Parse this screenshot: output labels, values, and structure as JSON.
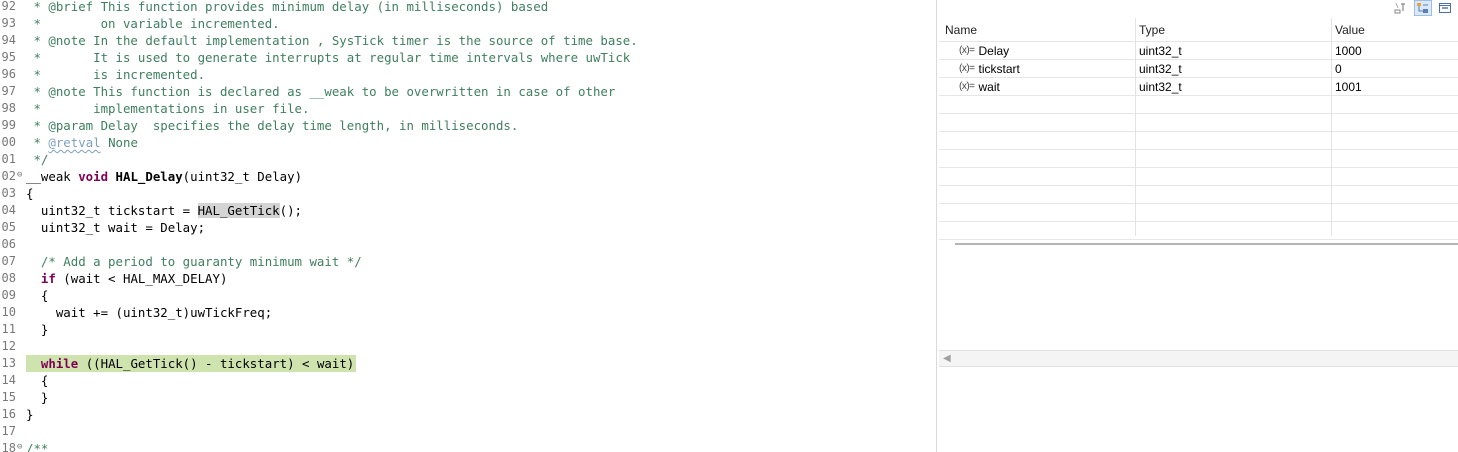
{
  "editor": {
    "lines": [
      {
        "n": "92",
        "fold": false,
        "hl": false,
        "t": [
          {
            "c": "cm",
            "s": " * @brief This function provides minimum delay (in milliseconds) based"
          }
        ]
      },
      {
        "n": "93",
        "fold": false,
        "hl": false,
        "t": [
          {
            "c": "cm",
            "s": " *        on variable incremented."
          }
        ]
      },
      {
        "n": "94",
        "fold": false,
        "hl": false,
        "t": [
          {
            "c": "cm",
            "s": " * @note In the default implementation , SysTick timer is the source of time base."
          }
        ]
      },
      {
        "n": "95",
        "fold": false,
        "hl": false,
        "t": [
          {
            "c": "cm",
            "s": " *       It is used to generate interrupts at regular time intervals where uwTick"
          }
        ]
      },
      {
        "n": "96",
        "fold": false,
        "hl": false,
        "t": [
          {
            "c": "cm",
            "s": " *       is incremented."
          }
        ]
      },
      {
        "n": "97",
        "fold": false,
        "hl": false,
        "t": [
          {
            "c": "cm",
            "s": " * @note This function is declared as __weak to be overwritten in case of other"
          }
        ]
      },
      {
        "n": "98",
        "fold": false,
        "hl": false,
        "t": [
          {
            "c": "cm",
            "s": " *       implementations in user file."
          }
        ]
      },
      {
        "n": "99",
        "fold": false,
        "hl": false,
        "t": [
          {
            "c": "cm",
            "s": " * @param Delay  specifies the delay time length, in milliseconds."
          }
        ]
      },
      {
        "n": "00",
        "fold": false,
        "hl": false,
        "t": [
          {
            "c": "cm",
            "s": " * "
          },
          {
            "c": "tg",
            "s": "@retval"
          },
          {
            "c": "cm",
            "s": " None"
          }
        ]
      },
      {
        "n": "01",
        "fold": false,
        "hl": false,
        "t": [
          {
            "c": "cm",
            "s": " */"
          }
        ]
      },
      {
        "n": "02",
        "fold": true,
        "hl": false,
        "t": [
          {
            "c": "plain",
            "s": "__weak "
          },
          {
            "c": "kw",
            "s": "void"
          },
          {
            "c": "plain",
            "s": " "
          },
          {
            "c": "fn",
            "s": "HAL_Delay"
          },
          {
            "c": "plain",
            "s": "(uint32_t Delay)"
          }
        ]
      },
      {
        "n": "03",
        "fold": false,
        "hl": false,
        "t": [
          {
            "c": "plain",
            "s": "{"
          }
        ]
      },
      {
        "n": "04",
        "fold": false,
        "hl": false,
        "t": [
          {
            "c": "plain",
            "s": "  uint32_t tickstart = "
          },
          {
            "c": "occ",
            "s": "HAL_GetTick"
          },
          {
            "c": "plain",
            "s": "();"
          }
        ]
      },
      {
        "n": "05",
        "fold": false,
        "hl": false,
        "t": [
          {
            "c": "plain",
            "s": "  uint32_t wait = Delay;"
          }
        ]
      },
      {
        "n": "06",
        "fold": false,
        "hl": false,
        "t": [
          {
            "c": "plain",
            "s": ""
          }
        ]
      },
      {
        "n": "07",
        "fold": false,
        "hl": false,
        "t": [
          {
            "c": "cm",
            "s": "  /* Add a period to guaranty minimum wait */"
          }
        ]
      },
      {
        "n": "08",
        "fold": false,
        "hl": false,
        "t": [
          {
            "c": "plain",
            "s": "  "
          },
          {
            "c": "kw",
            "s": "if"
          },
          {
            "c": "plain",
            "s": " (wait < HAL_MAX_DELAY)"
          }
        ]
      },
      {
        "n": "09",
        "fold": false,
        "hl": false,
        "t": [
          {
            "c": "plain",
            "s": "  {"
          }
        ]
      },
      {
        "n": "10",
        "fold": false,
        "hl": false,
        "t": [
          {
            "c": "plain",
            "s": "    wait += (uint32_t)uwTickFreq;"
          }
        ]
      },
      {
        "n": "11",
        "fold": false,
        "hl": false,
        "t": [
          {
            "c": "plain",
            "s": "  }"
          }
        ]
      },
      {
        "n": "12",
        "fold": false,
        "hl": false,
        "t": [
          {
            "c": "plain",
            "s": ""
          }
        ]
      },
      {
        "n": "13",
        "fold": false,
        "hl": true,
        "t": [
          {
            "c": "plain",
            "s": "  "
          },
          {
            "c": "kw",
            "s": "while"
          },
          {
            "c": "plain",
            "s": " ((HAL_GetTick() - tickstart) < wait)"
          }
        ]
      },
      {
        "n": "14",
        "fold": false,
        "hl": false,
        "t": [
          {
            "c": "plain",
            "s": "  {"
          }
        ]
      },
      {
        "n": "15",
        "fold": false,
        "hl": false,
        "t": [
          {
            "c": "plain",
            "s": "  }"
          }
        ]
      },
      {
        "n": "16",
        "fold": false,
        "hl": false,
        "t": [
          {
            "c": "plain",
            "s": "}"
          }
        ]
      },
      {
        "n": "17",
        "fold": false,
        "hl": false,
        "t": [
          {
            "c": "plain",
            "s": ""
          }
        ]
      },
      {
        "n": "18",
        "fold": true,
        "hl": false,
        "t": [
          {
            "c": "cm",
            "s": "/**"
          }
        ]
      }
    ]
  },
  "variables": {
    "columns": {
      "name": "Name",
      "type": "Type",
      "value": "Value"
    },
    "icon_label": "(x)=",
    "rows": [
      {
        "name": "Delay",
        "type": "uint32_t",
        "value": "1000"
      },
      {
        "name": "tickstart",
        "type": "uint32_t",
        "value": "0"
      },
      {
        "name": "wait",
        "type": "uint32_t",
        "value": "1001"
      }
    ],
    "empty_rows": 8,
    "toolbar": [
      "show-type-names-icon",
      "show-logical-structure-icon",
      "collapse-all-icon"
    ],
    "scroll_left_glyph": "◀"
  },
  "colors": {
    "comment": "#3f7f5f",
    "keyword": "#7f0055",
    "javadoc_tag": "#7f9fbf",
    "current_line": "#cfe3ae",
    "occurrence": "#d4d4d4"
  }
}
